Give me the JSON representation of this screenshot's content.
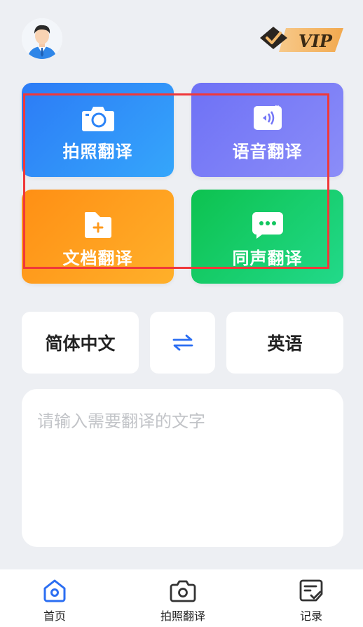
{
  "header": {
    "avatar_icon": "user-avatar-icon",
    "vip_label": "VIP",
    "vip_icon": "vip-check-icon"
  },
  "features": [
    {
      "label": "拍照翻译",
      "icon": "camera-icon"
    },
    {
      "label": "语音翻译",
      "icon": "voice-icon"
    },
    {
      "label": "文档翻译",
      "icon": "folder-plus-icon"
    },
    {
      "label": "同声翻译",
      "icon": "chat-bubble-icon"
    }
  ],
  "colors": {
    "photo": "#2C7BF6",
    "voice": "#7577F7",
    "doc": "#FF9A1C",
    "simul": "#12C65F",
    "highlight": "#F0383A",
    "accent": "#2B6EF2"
  },
  "language": {
    "source": "简体中文",
    "target": "英语",
    "swap_icon": "swap-arrows-icon"
  },
  "input": {
    "placeholder": "请输入需要翻译的文字"
  },
  "tabbar": {
    "items": [
      {
        "label": "首页",
        "icon": "home-icon",
        "active": true
      },
      {
        "label": "拍照翻译",
        "icon": "camera-icon",
        "active": false
      },
      {
        "label": "记录",
        "icon": "record-icon",
        "active": false
      }
    ]
  }
}
